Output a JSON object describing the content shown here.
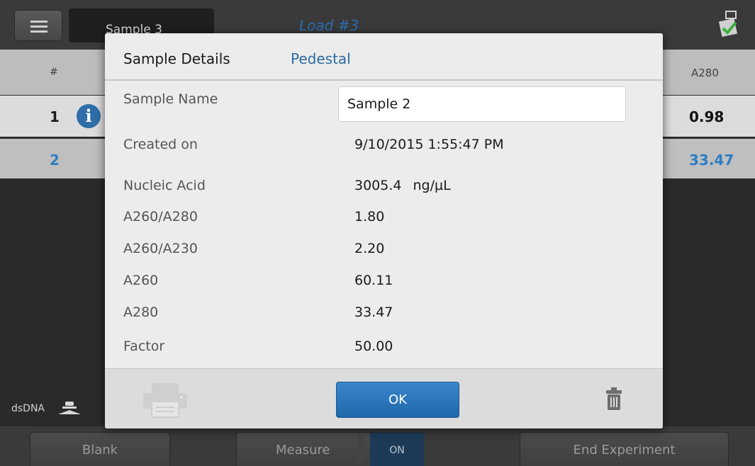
{
  "header": {
    "sample_selector": "Sample 3",
    "load_title": "Load #3"
  },
  "table": {
    "col_number": "#",
    "col_a280": "A280",
    "rows": [
      {
        "number": "1",
        "a280": "0.98"
      },
      {
        "number": "2",
        "a280": "33.47"
      }
    ]
  },
  "footer_status": {
    "sample_type": "dsDNA"
  },
  "bottom_bar": {
    "blank_label": "Blank",
    "measure_label": "Measure",
    "measure_state": "ON",
    "end_label": "End Experiment"
  },
  "dialog": {
    "title": "Sample Details",
    "tab": "Pedestal",
    "sample_name_label": "Sample Name",
    "sample_name_value": "Sample 2",
    "created_label": "Created on",
    "created_value": "9/10/2015 1:55:47 PM",
    "nucleic_acid_label": "Nucleic Acid",
    "nucleic_acid_value": "3005.4",
    "nucleic_acid_unit": "ng/µL",
    "a260_a280_label": "A260/A280",
    "a260_a280_value": "1.80",
    "a260_a230_label": "A260/A230",
    "a260_a230_value": "2.20",
    "a260_label": "A260",
    "a260_value": "60.11",
    "a280_label": "A280",
    "a280_value": "33.47",
    "factor_label": "Factor",
    "factor_value": "50.00",
    "ok_label": "OK"
  },
  "colors": {
    "accent_blue": "#2b6aa3",
    "ok_button": "#2874b8",
    "row_highlight_text": "#2e7fc2"
  }
}
